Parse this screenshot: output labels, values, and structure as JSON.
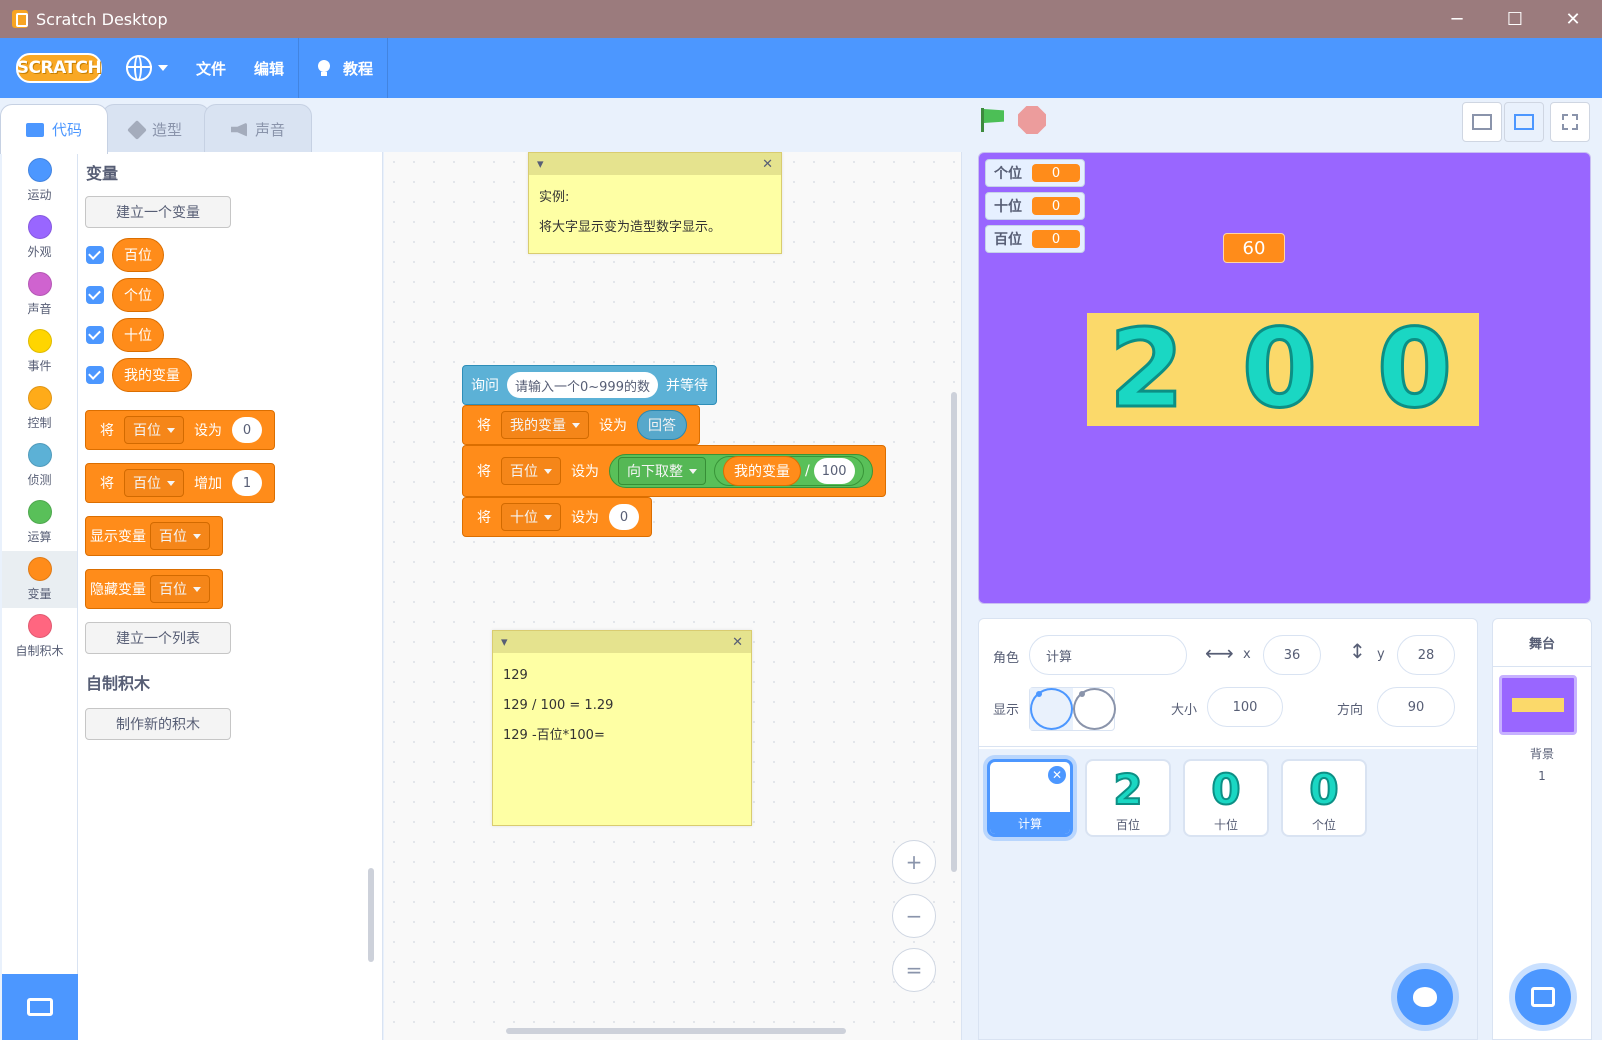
{
  "window": {
    "title": "Scratch Desktop",
    "minimize": "─",
    "maximize": "☐",
    "close": "✕"
  },
  "menu": {
    "logo": "SCRATCH",
    "file": "文件",
    "edit": "编辑",
    "tutorials": "教程"
  },
  "tabs": {
    "code": "代码",
    "costumes": "造型",
    "sounds": "声音"
  },
  "categories": [
    {
      "label": "运动",
      "color": "#4c97ff"
    },
    {
      "label": "外观",
      "color": "#9966ff"
    },
    {
      "label": "声音",
      "color": "#cf63cf"
    },
    {
      "label": "事件",
      "color": "#ffd500"
    },
    {
      "label": "控制",
      "color": "#ffab19"
    },
    {
      "label": "侦测",
      "color": "#5cb1d6"
    },
    {
      "label": "运算",
      "color": "#59c059"
    },
    {
      "label": "变量",
      "color": "#ff8c1a"
    },
    {
      "label": "自制积木",
      "color": "#ff6680"
    }
  ],
  "palette": {
    "heading_variables": "变量",
    "make_variable": "建立一个变量",
    "variables": [
      "百位",
      "个位",
      "十位",
      "我的变量"
    ],
    "set": {
      "a": "将",
      "var": "百位",
      "b": "设为",
      "value": "0"
    },
    "change": {
      "a": "将",
      "var": "百位",
      "b": "增加",
      "value": "1"
    },
    "show": {
      "a": "显示变量",
      "var": "百位"
    },
    "hide": {
      "a": "隐藏变量",
      "var": "百位"
    },
    "make_list": "建立一个列表",
    "heading_myblocks": "自制积木",
    "make_block": "制作新的积木"
  },
  "script": {
    "note1": {
      "line1": "实例:",
      "line2": "将大字显示变为造型数字显示。"
    },
    "ask": {
      "a": "询问",
      "prompt": "请输入一个0~999的数",
      "b": "并等待"
    },
    "set1": {
      "a": "将",
      "var": "我的变量",
      "b": "设为",
      "answer": "回答"
    },
    "set2": {
      "a": "将",
      "var": "百位",
      "b": "设为",
      "op": "向下取整",
      "var2": "我的变量",
      "div": "/",
      "num": "100"
    },
    "set3": {
      "a": "将",
      "var": "十位",
      "b": "设为",
      "value": "0"
    },
    "note2": {
      "line1": "129",
      "line2": "129 / 100 = 1.29",
      "line3": "129 -百位*100="
    },
    "zoom_in": "+",
    "zoom_out": "−",
    "zoom_reset": "="
  },
  "stage": {
    "monitors": [
      {
        "name": "个位",
        "value": "0"
      },
      {
        "name": "十位",
        "value": "0"
      },
      {
        "name": "百位",
        "value": "0"
      }
    ],
    "say": "60",
    "digits": [
      "2",
      "0",
      "0"
    ]
  },
  "sprite_info": {
    "sprite_label": "角色",
    "sprite_name": "计算",
    "x_label": "x",
    "x": "36",
    "y_label": "y",
    "y": "28",
    "show_label": "显示",
    "size_label": "大小",
    "size": "100",
    "direction_label": "方向",
    "direction": "90"
  },
  "sprites": [
    {
      "name": "计算",
      "glyph": "",
      "selected": true
    },
    {
      "name": "百位",
      "glyph": "2"
    },
    {
      "name": "十位",
      "glyph": "0"
    },
    {
      "name": "个位",
      "glyph": "0"
    }
  ],
  "stage_pane": {
    "title": "舞台",
    "backdrops_label": "背景",
    "backdrops_count": "1"
  }
}
